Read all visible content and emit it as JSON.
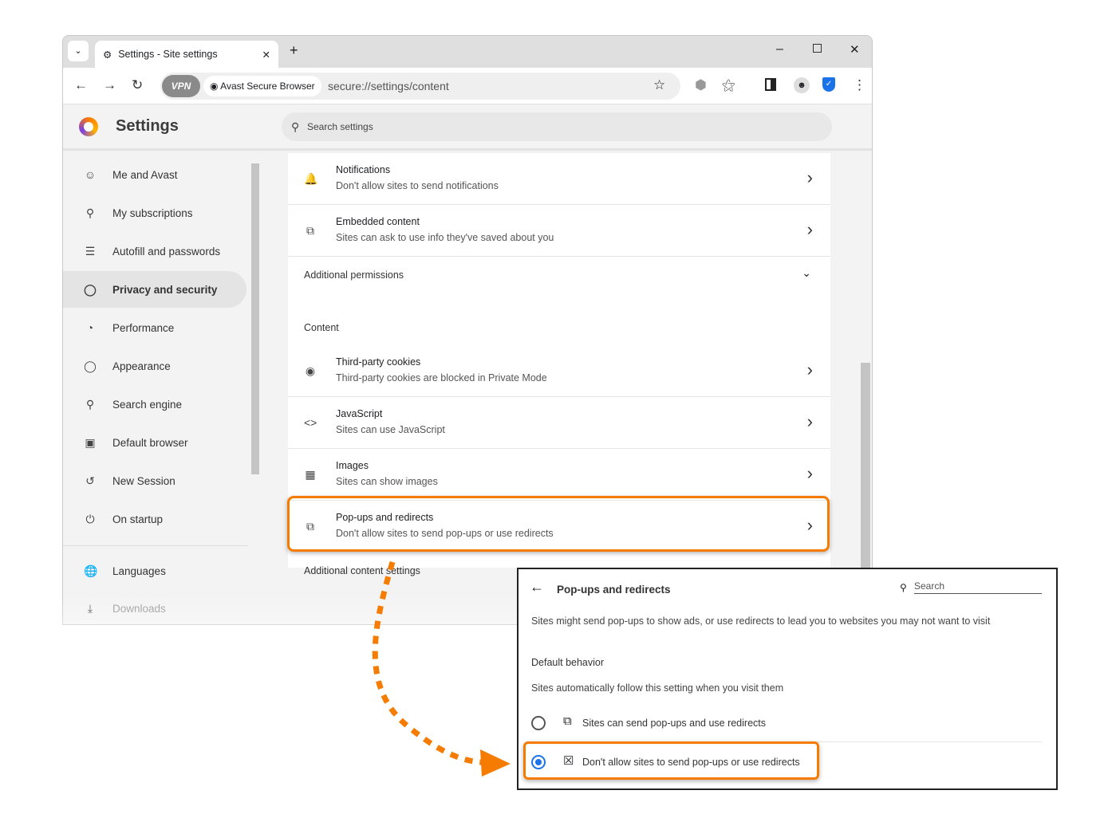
{
  "browser": {
    "tab_title": "Settings - Site settings",
    "new_tab": "+",
    "vpn_label": "VPN",
    "site_chip": "Avast Secure Browser",
    "url": "secure://settings/content"
  },
  "header": {
    "title": "Settings",
    "search_placeholder": "Search settings"
  },
  "sidebar": {
    "items": [
      {
        "label": "Me and Avast",
        "icon": "person-icon"
      },
      {
        "label": "My subscriptions",
        "icon": "key-icon"
      },
      {
        "label": "Autofill and passwords",
        "icon": "list-icon"
      },
      {
        "label": "Privacy and security",
        "icon": "shield-icon",
        "active": true
      },
      {
        "label": "Performance",
        "icon": "gauge-icon"
      },
      {
        "label": "Appearance",
        "icon": "palette-icon"
      },
      {
        "label": "Search engine",
        "icon": "search-icon"
      },
      {
        "label": "Default browser",
        "icon": "browser-icon"
      },
      {
        "label": "New Session",
        "icon": "session-icon"
      },
      {
        "label": "On startup",
        "icon": "power-icon"
      },
      {
        "label": "Languages",
        "icon": "globe-icon"
      },
      {
        "label": "Downloads",
        "icon": "download-icon"
      }
    ]
  },
  "main": {
    "rows_top": [
      {
        "title": "Notifications",
        "subtitle": "Don't allow sites to send notifications"
      },
      {
        "title": "Embedded content",
        "subtitle": "Sites can ask to use info they've saved about you"
      }
    ],
    "additional_permissions": "Additional permissions",
    "content_label": "Content",
    "rows_content": [
      {
        "title": "Third-party cookies",
        "subtitle": "Third-party cookies are blocked in Private Mode"
      },
      {
        "title": "JavaScript",
        "subtitle": "Sites can use JavaScript"
      },
      {
        "title": "Images",
        "subtitle": "Sites can show images"
      },
      {
        "title": "Pop-ups and redirects",
        "subtitle": "Don't allow sites to send pop-ups or use redirects"
      }
    ],
    "additional_content": "Additional content settings"
  },
  "panel": {
    "title": "Pop-ups and redirects",
    "search_placeholder": "Search",
    "description": "Sites might send pop-ups to show ads, or use redirects to lead you to websites you may not want to visit",
    "default_behavior": "Default behavior",
    "default_desc": "Sites automatically follow this setting when you visit them",
    "options": [
      {
        "label": "Sites can send pop-ups and use redirects",
        "selected": false
      },
      {
        "label": "Don't allow sites to send pop-ups or use redirects",
        "selected": true
      }
    ]
  },
  "colors": {
    "highlight": "#f57c00",
    "accent": "#1a73e8"
  }
}
